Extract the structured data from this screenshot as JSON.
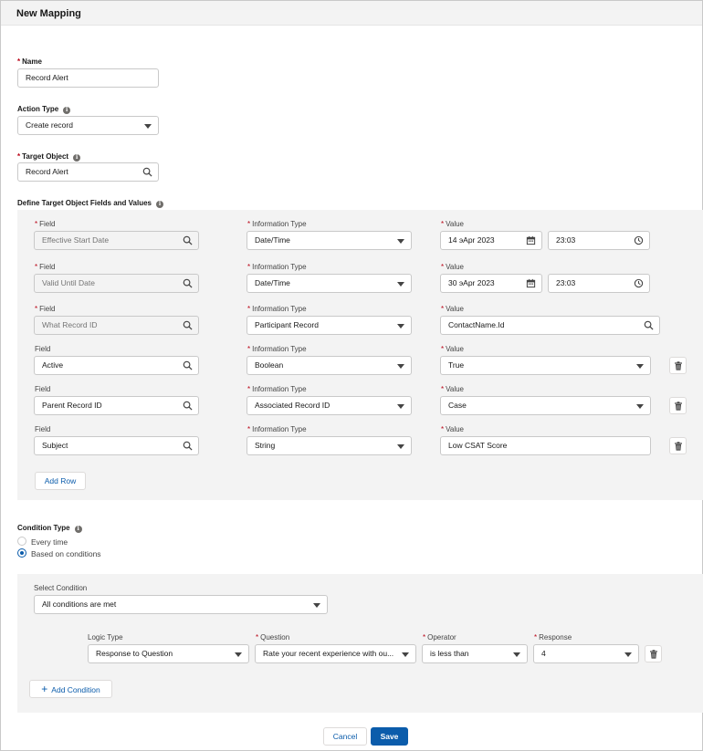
{
  "header": {
    "title": "New Mapping"
  },
  "name": {
    "label": "Name",
    "value": "Record Alert"
  },
  "action_type": {
    "label": "Action Type",
    "value": "Create record"
  },
  "target_object": {
    "label": "Target Object",
    "value": "Record Alert"
  },
  "fields_section": {
    "label": "Define Target Object Fields and Values"
  },
  "field_rows": [
    {
      "field_label": "Field",
      "field_required": true,
      "field_value": "Effective Start Date",
      "field_disabled": true,
      "type_label": "Information Type",
      "type_value": "Date/Time",
      "value_label": "Value",
      "date": "14 эApr 2023",
      "time": "23:03",
      "kind": "datetime"
    },
    {
      "field_label": "Field",
      "field_required": true,
      "field_value": "Valid Until Date",
      "field_disabled": true,
      "type_label": "Information Type",
      "type_value": "Date/Time",
      "value_label": "Value",
      "date": "30 эApr 2023",
      "time": "23:03",
      "kind": "datetime"
    },
    {
      "field_label": "Field",
      "field_required": true,
      "field_value": "What Record ID",
      "field_disabled": true,
      "type_label": "Information Type",
      "type_value": "Participant Record",
      "value_label": "Value",
      "value": "ContactName.Id",
      "kind": "lookup"
    },
    {
      "field_label": "Field",
      "field_required": false,
      "field_value": "Active",
      "field_disabled": false,
      "type_label": "Information Type",
      "type_value": "Boolean",
      "value_label": "Value",
      "value": "True",
      "kind": "picklist"
    },
    {
      "field_label": "Field",
      "field_required": false,
      "field_value": "Parent Record ID",
      "field_disabled": false,
      "type_label": "Information Type",
      "type_value": "Associated Record ID",
      "value_label": "Value",
      "value": "Case",
      "kind": "picklist"
    },
    {
      "field_label": "Field",
      "field_required": false,
      "field_value": "Subject",
      "field_disabled": false,
      "type_label": "Information Type",
      "type_value": "String",
      "value_label": "Value",
      "value": "Low CSAT Score",
      "kind": "text"
    }
  ],
  "add_row_label": "Add Row",
  "condition_type": {
    "label": "Condition Type",
    "options": [
      "Every time",
      "Based on conditions"
    ],
    "selected": "Based on conditions"
  },
  "select_condition": {
    "label": "Select Condition",
    "value": "All conditions are met"
  },
  "condition_row": {
    "logic_label": "Logic Type",
    "logic_value": "Response to Question",
    "question_label": "Question",
    "question_value": "Rate your recent experience with ou...",
    "operator_label": "Operator",
    "operator_value": "is less than",
    "response_label": "Response",
    "response_value": "4"
  },
  "add_condition_label": "Add Condition",
  "footer": {
    "cancel_label": "Cancel",
    "save_label": "Save"
  },
  "colors": {
    "brand": "#0b5cab",
    "required": "#ba0517",
    "panel": "#f3f3f3"
  }
}
